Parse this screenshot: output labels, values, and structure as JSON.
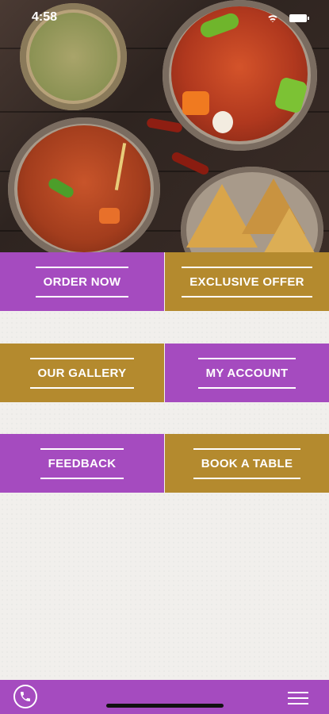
{
  "status_bar": {
    "time": "4:58"
  },
  "menu": {
    "rows": [
      {
        "left": {
          "label": "ORDER NOW",
          "color": "#a54bbf"
        },
        "right": {
          "label": "EXCLUSIVE OFFER",
          "color": "#b48a2e"
        }
      },
      {
        "left": {
          "label": "OUR GALLERY",
          "color": "#b48a2e"
        },
        "right": {
          "label": "MY ACCOUNT",
          "color": "#a54bbf"
        }
      },
      {
        "left": {
          "label": "FEEDBACK",
          "color": "#a54bbf"
        },
        "right": {
          "label": "BOOK A TABLE",
          "color": "#b48a2e"
        }
      }
    ]
  },
  "bottom_bar": {
    "phone_icon": "phone-icon",
    "menu_icon": "hamburger-menu-icon",
    "color": "#a54bbf"
  }
}
